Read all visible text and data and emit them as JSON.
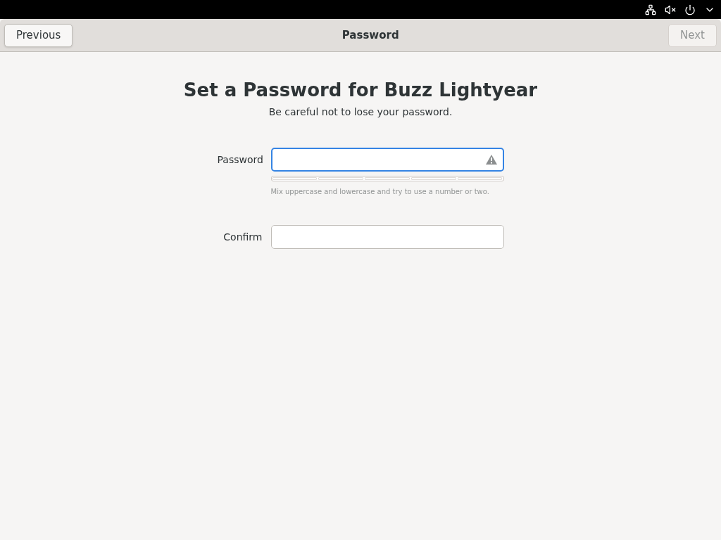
{
  "header": {
    "title": "Password",
    "buttons": [
      {
        "label": "Previous",
        "disabled": false
      },
      {
        "label": "Next",
        "disabled": true
      }
    ]
  },
  "heading": "Set a Password for Buzz Lightyear",
  "subtitle": "Be careful not to lose your password.",
  "fields": [
    {
      "label": "Password",
      "focused": true,
      "warning": true,
      "strength_meter": true,
      "hint": "Mix uppercase and lowercase and try to use a number or two."
    },
    {
      "label": "Confirm",
      "focused": false
    }
  ]
}
